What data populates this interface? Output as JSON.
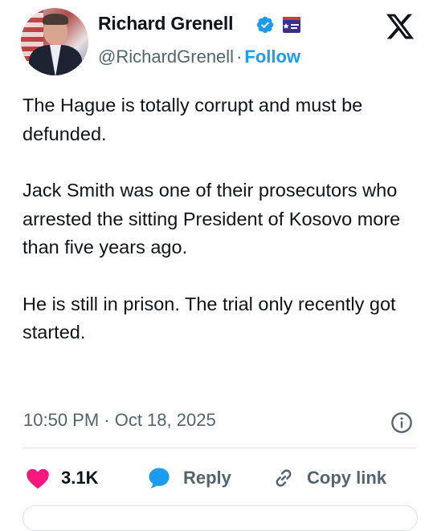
{
  "author": {
    "display_name": "Richard Grenell",
    "handle": "@RichardGrenell",
    "follow_label": "Follow",
    "separator": "·",
    "verified_color": "#1d9bf0"
  },
  "icons": {
    "brand": "x-logo-icon",
    "verified": "verified-badge-icon",
    "affiliation": "affiliate-badge-icon",
    "info": "info-icon",
    "like": "heart-icon",
    "reply": "speech-bubble-icon",
    "copy": "link-icon"
  },
  "tweet": {
    "paragraphs": [
      "The Hague is totally corrupt and must be defunded.",
      "Jack Smith was one of their prosecutors who arrested the sitting President of Kosovo more than five years ago.",
      "He is still in prison. The trial only recently got started."
    ],
    "timestamp": "10:50 PM · Oct 18, 2025"
  },
  "actions": {
    "like_count": "3.1K",
    "reply_label": "Reply",
    "copy_label": "Copy link"
  },
  "colors": {
    "like": "#f91880",
    "reply": "#1d9bf0",
    "link_blue": "#1d9bf0",
    "muted": "#536471",
    "text": "#0f1419"
  }
}
